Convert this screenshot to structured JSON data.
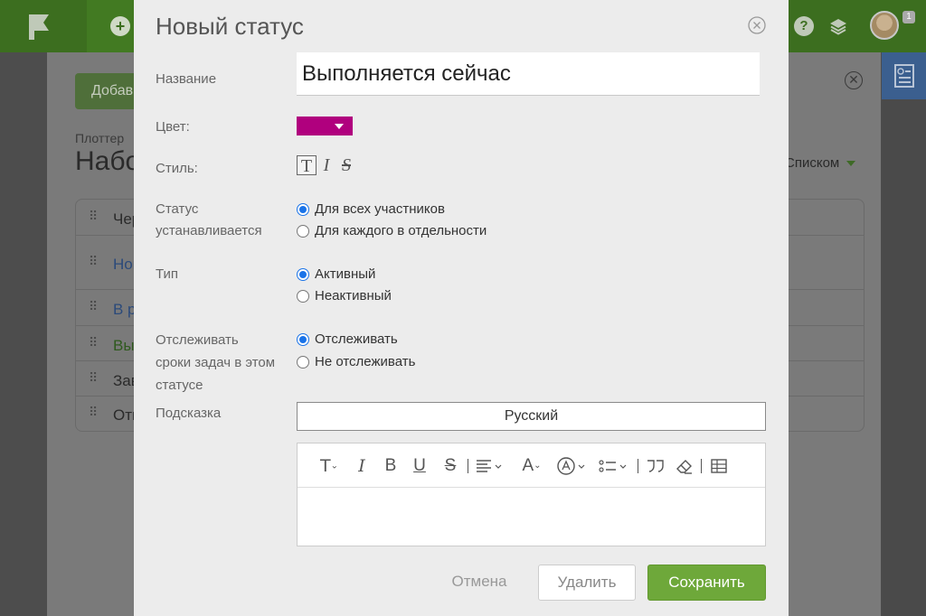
{
  "background": {
    "add_button": "Добавить",
    "breadcrumb": "Плоттер",
    "heading": "Набор статусов",
    "view_mode": "Списком",
    "user_badge": "1",
    "rows": [
      {
        "label": "Черновик",
        "color": "#2a2a2a"
      },
      {
        "label": "Новая",
        "color": "#2b4a7a"
      },
      {
        "label": "В работе",
        "color": "#2b4a7a"
      },
      {
        "label": "Выполнена",
        "color": "#2f5a1e"
      },
      {
        "label": "Завершена",
        "color": "#2a2a2a"
      },
      {
        "label": "Отменена",
        "color": "#2a2a2a"
      }
    ]
  },
  "modal": {
    "title": "Новый статус",
    "name_label": "Название",
    "name_value": "Выполняется сейчас",
    "color_label": "Цвет:",
    "color_value": "#b0007e",
    "style_label": "Стиль:",
    "style_options": [
      "T",
      "I",
      "S"
    ],
    "setting_label_line1": "Статус",
    "setting_label_line2": "устанавливается",
    "setting_options": [
      "Для всех участников",
      "Для каждого в отдельности"
    ],
    "type_label": "Тип",
    "type_options": [
      "Активный",
      "Неактивный"
    ],
    "track_label_line1": "Отслеживать",
    "track_label_line2": "сроки задач в этом",
    "track_label_line3": "статусе",
    "track_options": [
      "Отслеживать",
      "Не отслеживать"
    ],
    "hint_label": "Подсказка",
    "language": "Русский",
    "cancel_label": "Отмена",
    "delete_label": "Удалить",
    "save_label": "Сохранить"
  },
  "colors": {
    "topbar": "#3c6e1f",
    "save_button": "#6ea83a",
    "status_color": "#b0007e",
    "radio_selected": "#1a73e8"
  }
}
